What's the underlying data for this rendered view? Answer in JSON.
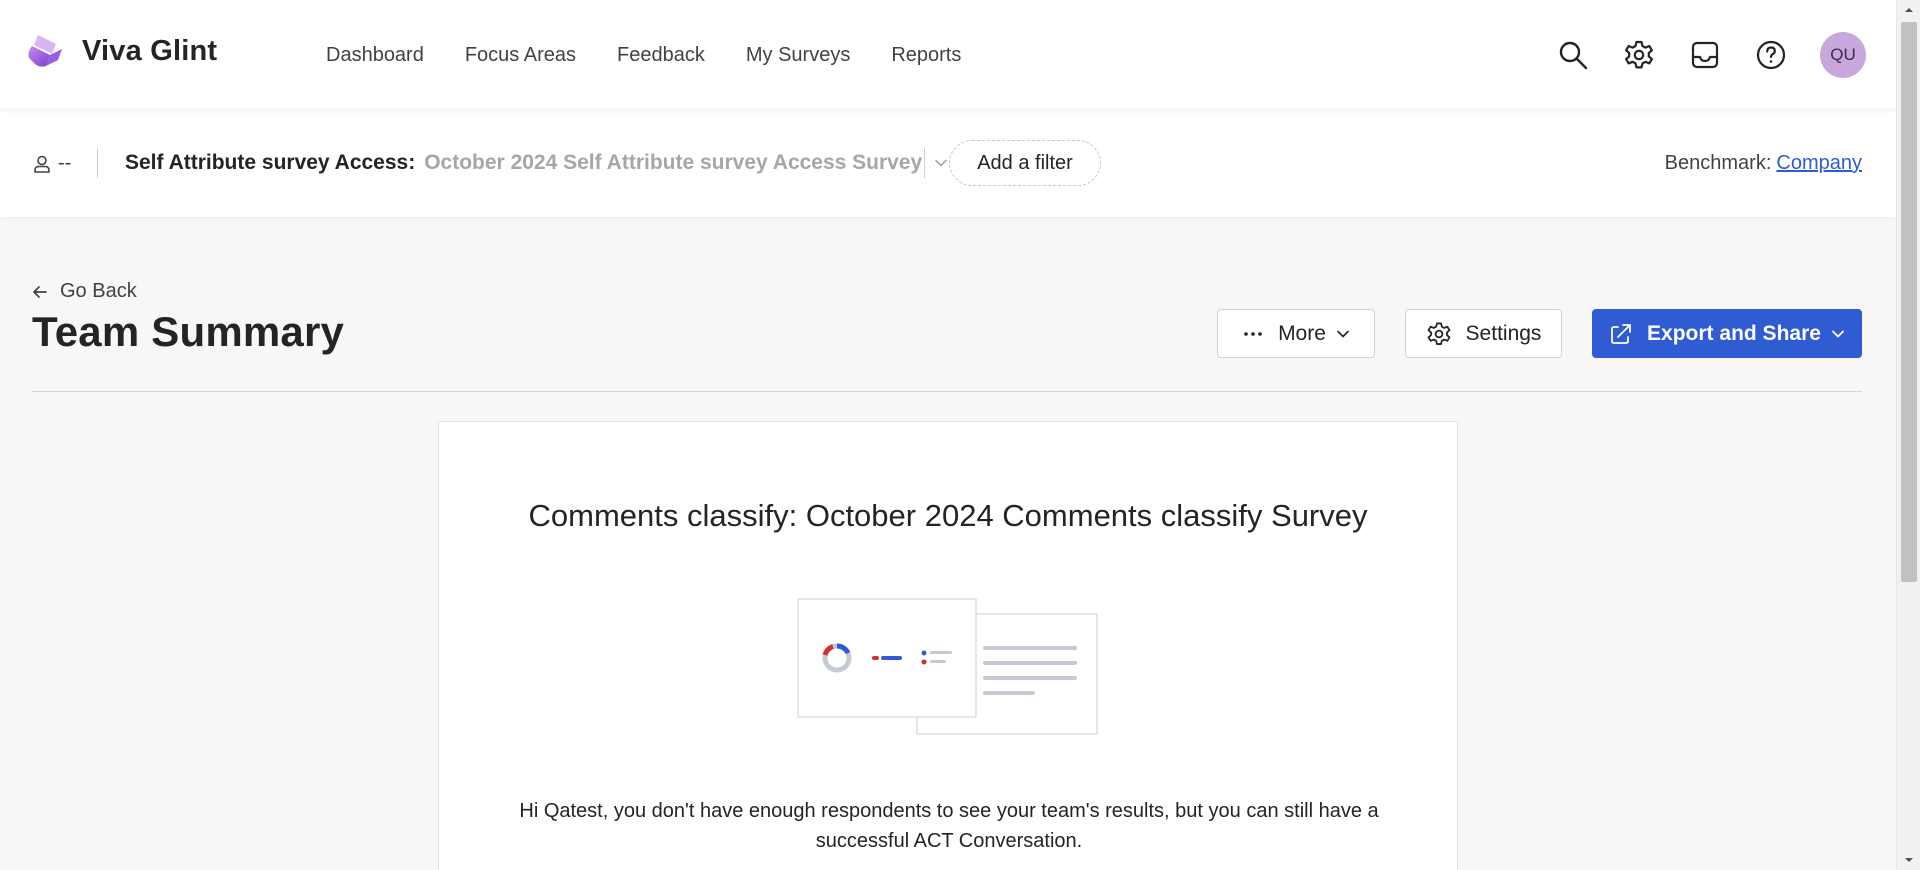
{
  "app": {
    "name": "Viva Glint"
  },
  "nav": {
    "items": [
      {
        "label": "Dashboard"
      },
      {
        "label": "Focus Areas"
      },
      {
        "label": "Feedback"
      },
      {
        "label": "My Surveys"
      },
      {
        "label": "Reports"
      }
    ]
  },
  "header_actions": {
    "icons": [
      "search-icon",
      "gear-icon",
      "inbox-icon",
      "help-icon"
    ],
    "avatar_initials": "QU",
    "avatar_color": "#c9a7dc"
  },
  "filters": {
    "user_value": "--",
    "survey_label": "Self Attribute survey Access:",
    "survey_value": "October 2024 Self Attribute survey Access Survey",
    "add_filter_label": "Add a filter",
    "benchmark_label": "Benchmark:",
    "benchmark_value": "Company"
  },
  "page": {
    "back_label": "Go Back",
    "title": "Team Summary",
    "more_label": "More",
    "settings_label": "Settings",
    "export_label": "Export and Share"
  },
  "card": {
    "title": "Comments classify: October 2024 Comments classify Survey",
    "message": "Hi Qatest, you don't have enough respondents to see your team's results, but you can still have a successful ACT Conversation."
  },
  "colors": {
    "primary": "#2f5bd3",
    "brand_purple": "#8a55d6",
    "link": "#2f5bd3"
  }
}
